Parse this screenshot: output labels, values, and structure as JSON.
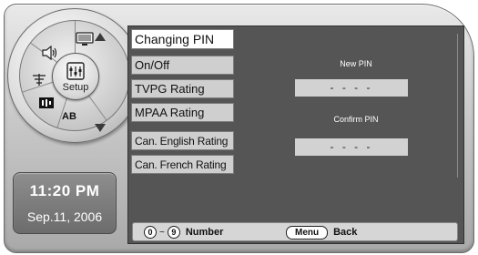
{
  "dial": {
    "center_label": "Setup",
    "icons": [
      "picture-icon",
      "sound-icon",
      "channel-antenna-icon",
      "input-icon",
      "ab-icon"
    ],
    "ab_label": "AB"
  },
  "clock": {
    "time": "11:20 PM",
    "date": "Sep.11, 2006"
  },
  "menu": {
    "title": "Changing PIN",
    "items": [
      {
        "label": "On/Off"
      },
      {
        "label": "TVPG Rating"
      },
      {
        "label": "MPAA Rating"
      },
      {
        "label": "Can. English Rating"
      },
      {
        "label": "Can. French Rating"
      }
    ]
  },
  "pin": {
    "new_label": "New PIN",
    "new_value": "- - - -",
    "confirm_label": "Confirm PIN",
    "confirm_value": "- - - -"
  },
  "help": {
    "key_from": "0",
    "key_sep": "~",
    "key_to": "9",
    "number_label": "Number",
    "menu_key": "Menu",
    "back_label": "Back"
  },
  "colors": {
    "screen_bg": "#555555",
    "menu_item_bg": "#cfcfcf",
    "menu_title_bg": "#ffffff",
    "clock_bg": "#7a7a7a"
  }
}
